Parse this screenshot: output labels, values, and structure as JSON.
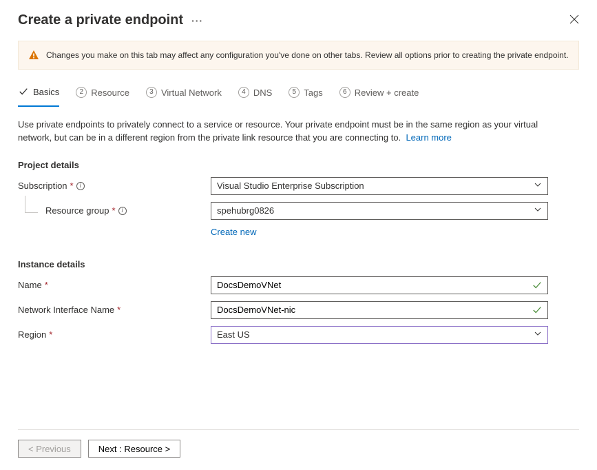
{
  "header": {
    "title": "Create a private endpoint"
  },
  "alert": {
    "message": "Changes you make on this tab may affect any configuration you've done on other tabs. Review all options prior to creating the private endpoint."
  },
  "tabs": [
    {
      "label": "Basics",
      "active": true
    },
    {
      "label": "Resource",
      "num": "2"
    },
    {
      "label": "Virtual Network",
      "num": "3"
    },
    {
      "label": "DNS",
      "num": "4"
    },
    {
      "label": "Tags",
      "num": "5"
    },
    {
      "label": "Review + create",
      "num": "6"
    }
  ],
  "description": "Use private endpoints to privately connect to a service or resource. Your private endpoint must be in the same region as your virtual network, but can be in a different region from the private link resource that you are connecting to.",
  "learn_more": "Learn more",
  "sections": {
    "project": {
      "title": "Project details",
      "subscription_label": "Subscription",
      "subscription_value": "Visual Studio Enterprise Subscription",
      "resource_group_label": "Resource group",
      "resource_group_value": "spehubrg0826",
      "create_new": "Create new"
    },
    "instance": {
      "title": "Instance details",
      "name_label": "Name",
      "name_value": "DocsDemoVNet",
      "nic_label": "Network Interface Name",
      "nic_value": "DocsDemoVNet-nic",
      "region_label": "Region",
      "region_value": "East US"
    }
  },
  "footer": {
    "previous": "< Previous",
    "next": "Next : Resource >"
  }
}
